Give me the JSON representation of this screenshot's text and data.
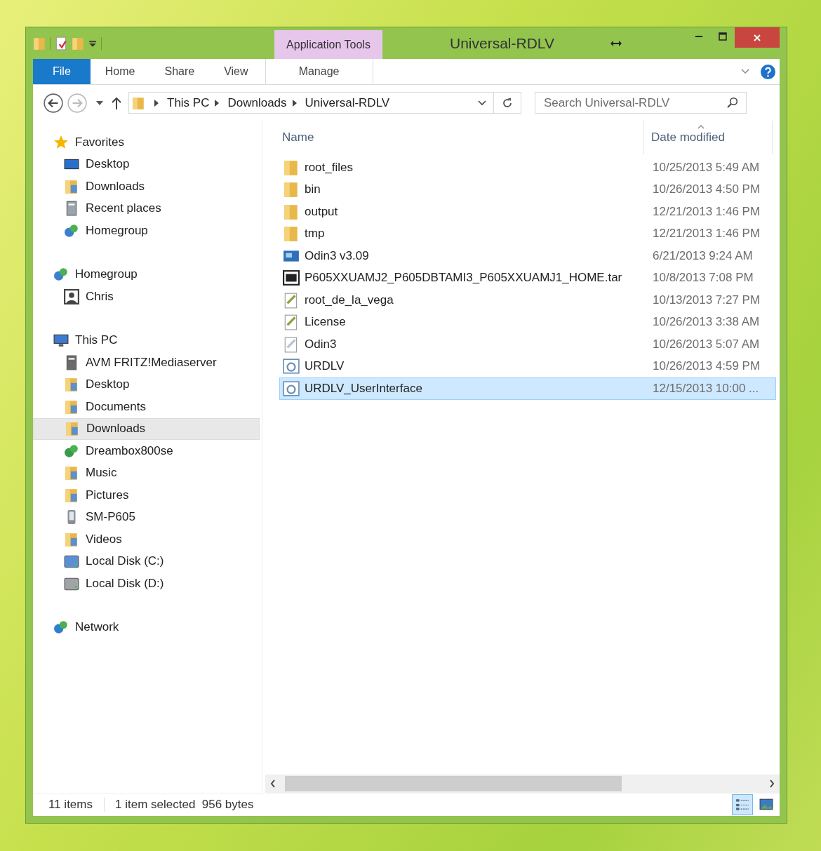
{
  "window": {
    "title": "Universal-RDLV",
    "context_tab_group": "Application Tools"
  },
  "ribbon_tabs": [
    {
      "label": "File",
      "kind": "file",
      "selected": false
    },
    {
      "label": "Home",
      "kind": "tab",
      "selected": false
    },
    {
      "label": "Share",
      "kind": "tab",
      "selected": false
    },
    {
      "label": "View",
      "kind": "tab",
      "selected": false
    },
    {
      "label": "Manage",
      "kind": "context",
      "selected": false
    }
  ],
  "breadcrumb": [
    "This PC",
    "Downloads",
    "Universal-RDLV"
  ],
  "search": {
    "placeholder": "Search Universal-RDLV"
  },
  "navigation": [
    {
      "label": "Favorites",
      "kind": "star",
      "selected": false,
      "children": [
        {
          "label": "Desktop",
          "kind": "desktop",
          "selected": false
        },
        {
          "label": "Downloads",
          "kind": "library",
          "selected": false
        },
        {
          "label": "Recent places",
          "kind": "recent",
          "selected": false
        },
        {
          "label": "Homegroup",
          "kind": "homegroup",
          "selected": false
        }
      ]
    },
    {
      "label": "Homegroup",
      "kind": "homegroup",
      "selected": false,
      "children": [
        {
          "label": "Chris",
          "kind": "user",
          "selected": false
        }
      ]
    },
    {
      "label": "This PC",
      "kind": "pc",
      "selected": false,
      "children": [
        {
          "label": "AVM FRITZ!Mediaserver",
          "kind": "media",
          "selected": false
        },
        {
          "label": "Desktop",
          "kind": "library",
          "selected": false
        },
        {
          "label": "Documents",
          "kind": "library",
          "selected": false
        },
        {
          "label": "Downloads",
          "kind": "library",
          "selected": true
        },
        {
          "label": "Dreambox800se",
          "kind": "netdevice",
          "selected": false
        },
        {
          "label": "Music",
          "kind": "library",
          "selected": false
        },
        {
          "label": "Pictures",
          "kind": "library",
          "selected": false
        },
        {
          "label": "SM-P605",
          "kind": "phone",
          "selected": false
        },
        {
          "label": "Videos",
          "kind": "library",
          "selected": false
        },
        {
          "label": "Local Disk (C:)",
          "kind": "sysdisk",
          "selected": false
        },
        {
          "label": "Local Disk (D:)",
          "kind": "disk",
          "selected": false
        }
      ]
    },
    {
      "label": "Network",
      "kind": "network",
      "selected": false
    }
  ],
  "columns": [
    {
      "label": "Name",
      "sorted": false
    },
    {
      "label": "Date modified",
      "sorted": true
    }
  ],
  "files": [
    {
      "name": "root_files",
      "date": "10/25/2013 5:49 AM",
      "kind": "folder",
      "selected": false
    },
    {
      "name": "bin",
      "date": "10/26/2013 4:50 PM",
      "kind": "folder",
      "selected": false
    },
    {
      "name": "output",
      "date": "12/21/2013 1:46 PM",
      "kind": "folder",
      "selected": false
    },
    {
      "name": "tmp",
      "date": "12/21/2013 1:46 PM",
      "kind": "folder",
      "selected": false
    },
    {
      "name": "Odin3 v3.09",
      "date": "6/21/2013 9:24 AM",
      "kind": "app",
      "selected": false
    },
    {
      "name": "P605XXUAMJ2_P605DBTAMI3_P605XXUAMJ1_HOME.tar",
      "date": "10/8/2013 7:08 PM",
      "kind": "archive",
      "selected": false
    },
    {
      "name": "root_de_la_vega",
      "date": "10/13/2013 7:27 PM",
      "kind": "script",
      "selected": false
    },
    {
      "name": "License",
      "date": "10/26/2013 3:38 AM",
      "kind": "script",
      "selected": false
    },
    {
      "name": "Odin3",
      "date": "10/26/2013 5:07 AM",
      "kind": "config",
      "selected": false
    },
    {
      "name": "URDLV",
      "date": "10/26/2013 4:59 PM",
      "kind": "batch",
      "selected": false
    },
    {
      "name": "URDLV_UserInterface",
      "date": "12/15/2013 10:00 ...",
      "kind": "batch",
      "selected": true
    }
  ],
  "status_bar": {
    "item_count": "11 items",
    "selection": "1 item selected  956 bytes",
    "views": [
      {
        "kind": "details",
        "selected": true
      },
      {
        "kind": "thumbnails",
        "selected": false
      }
    ]
  }
}
